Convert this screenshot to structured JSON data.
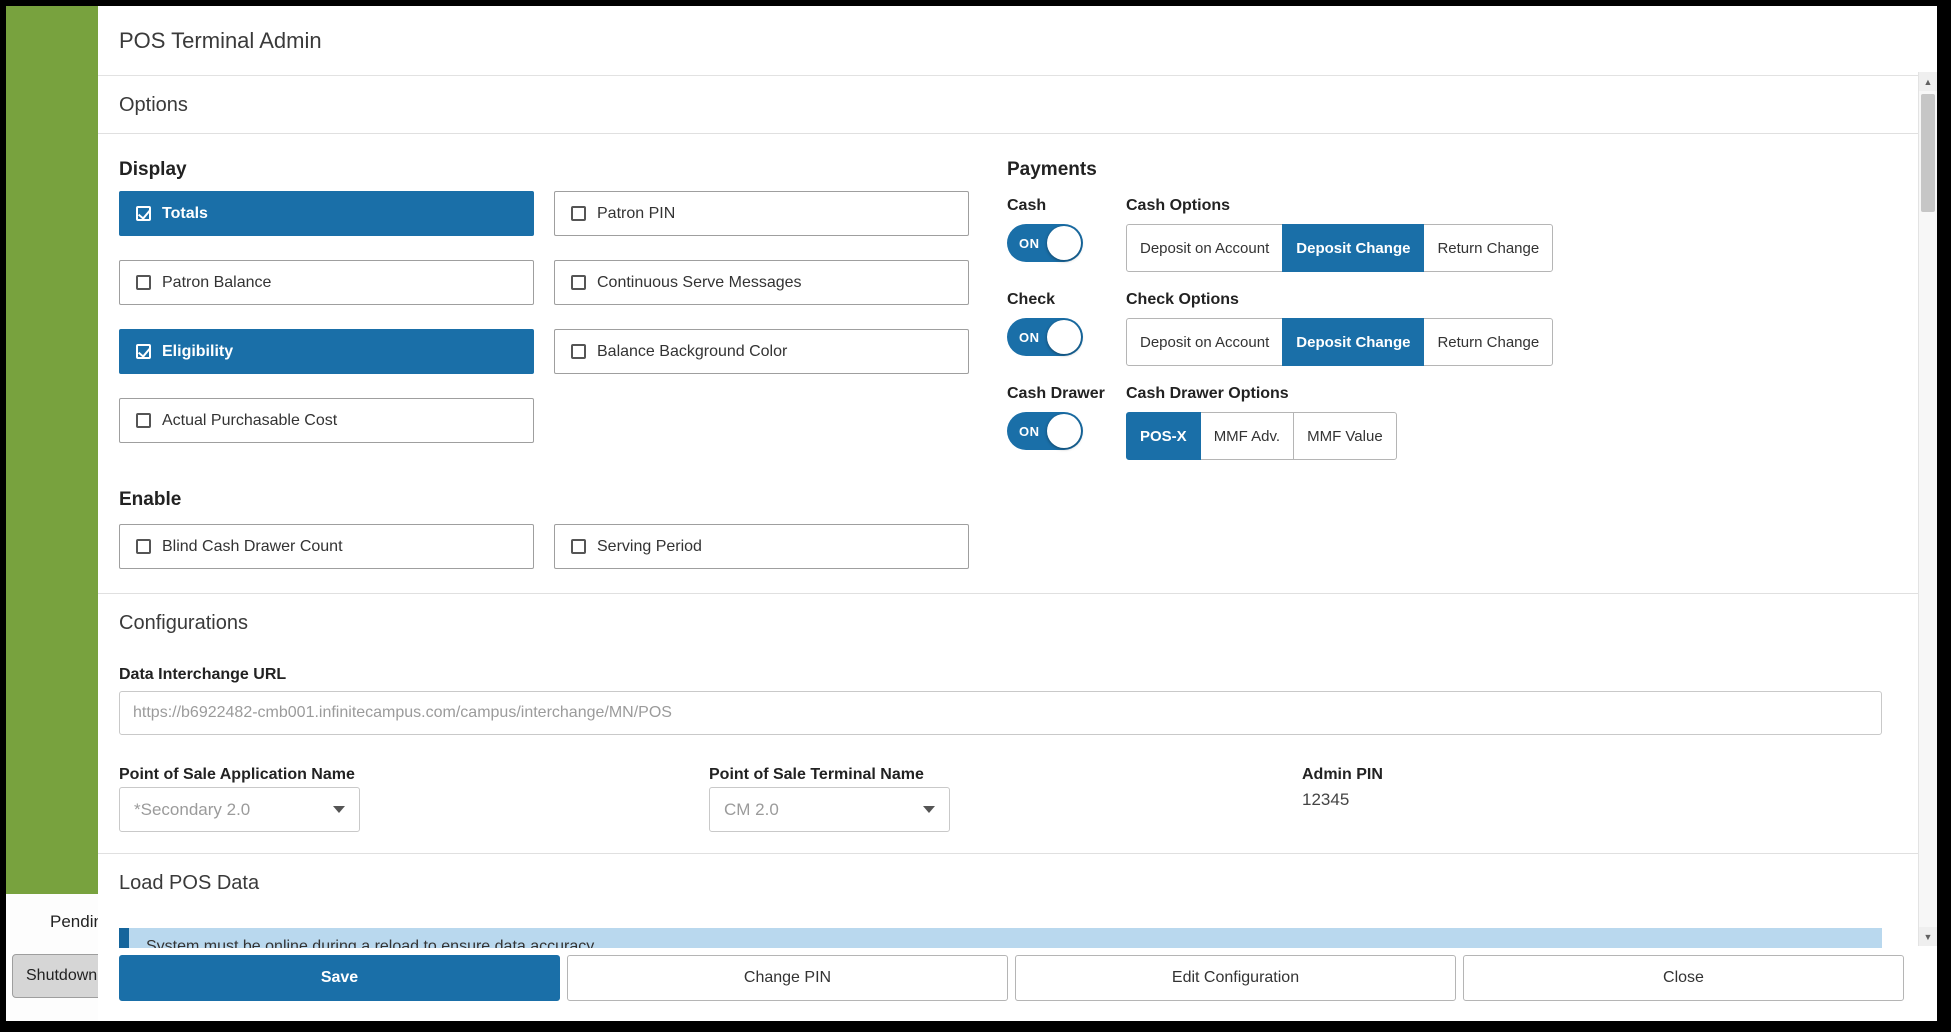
{
  "window": {
    "title": "POS Terminal Admin"
  },
  "underlay": {
    "pending_label": "Pending",
    "shutdown_label": "Shutdown"
  },
  "colors": {
    "accent_blue": "#1a6fa8",
    "sidebar_green": "#78a23e",
    "notice_background": "#b9d8ee",
    "notice_accent": "#15659c"
  },
  "icons": {
    "scroll_up": "▲",
    "scroll_down": "▼",
    "dropdown_caret": "▼",
    "checkbox_checked": "☑",
    "checkbox_unchecked": "☐"
  },
  "options": {
    "header": "Options",
    "display": {
      "heading": "Display",
      "items": [
        {
          "label": "Totals",
          "checked": true
        },
        {
          "label": "Patron PIN",
          "checked": false
        },
        {
          "label": "Patron Balance",
          "checked": false
        },
        {
          "label": "Continuous Serve Messages",
          "checked": false
        },
        {
          "label": "Eligibility",
          "checked": true
        },
        {
          "label": "Balance Background Color",
          "checked": false
        },
        {
          "label": "Actual Purchasable Cost",
          "checked": false
        }
      ]
    },
    "enable": {
      "heading": "Enable",
      "items": [
        {
          "label": "Blind Cash Drawer Count",
          "checked": false
        },
        {
          "label": "Serving Period",
          "checked": false
        }
      ]
    }
  },
  "payments": {
    "heading": "Payments",
    "rows": [
      {
        "toggle_label": "Cash",
        "toggle_state": "ON",
        "options_label": "Cash Options",
        "options": [
          {
            "label": "Deposit on Account",
            "selected": false
          },
          {
            "label": "Deposit Change",
            "selected": true
          },
          {
            "label": "Return Change",
            "selected": false
          }
        ]
      },
      {
        "toggle_label": "Check",
        "toggle_state": "ON",
        "options_label": "Check Options",
        "options": [
          {
            "label": "Deposit on Account",
            "selected": false
          },
          {
            "label": "Deposit Change",
            "selected": true
          },
          {
            "label": "Return Change",
            "selected": false
          }
        ]
      },
      {
        "toggle_label": "Cash Drawer",
        "toggle_state": "ON",
        "options_label": "Cash Drawer Options",
        "options": [
          {
            "label": "POS-X",
            "selected": true
          },
          {
            "label": "MMF Adv.",
            "selected": false
          },
          {
            "label": "MMF Value",
            "selected": false
          }
        ]
      }
    ]
  },
  "configurations": {
    "header": "Configurations",
    "url_label": "Data Interchange URL",
    "url_value": "https://b6922482-cmb001.infinitecampus.com/campus/interchange/MN/POS",
    "app_label": "Point of Sale Application Name",
    "app_value": "*Secondary 2.0",
    "terminal_label": "Point of Sale Terminal Name",
    "terminal_value": "CM 2.0",
    "pin_label": "Admin PIN",
    "pin_value": "12345"
  },
  "load": {
    "header": "Load POS Data",
    "notice": "System must be online during a reload to ensure data accuracy."
  },
  "footer": {
    "buttons": [
      {
        "label": "Save",
        "primary": true
      },
      {
        "label": "Change PIN",
        "primary": false
      },
      {
        "label": "Edit Configuration",
        "primary": false
      },
      {
        "label": "Close",
        "primary": false
      }
    ]
  }
}
